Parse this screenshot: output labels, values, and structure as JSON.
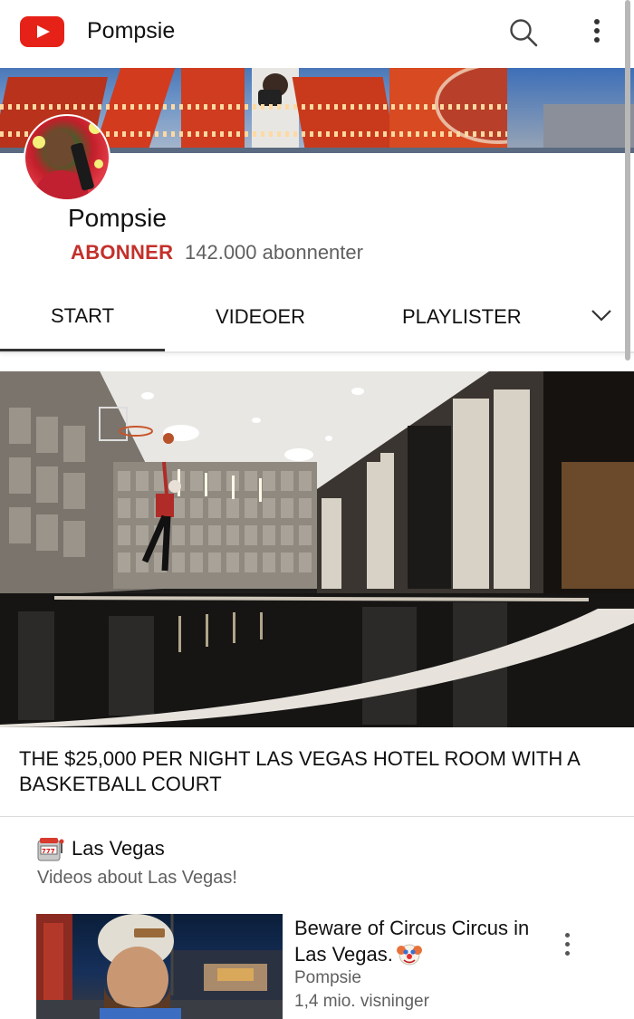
{
  "app": {
    "title": "Pompsie"
  },
  "channel": {
    "name": "Pompsie",
    "subscribe_label": "ABONNER",
    "subscriber_count": "142.000 abonnenter"
  },
  "tabs": [
    {
      "label": "START",
      "active": true
    },
    {
      "label": "VIDEOER",
      "active": false
    },
    {
      "label": "PLAYLISTER",
      "active": false
    }
  ],
  "featured": {
    "title": "THE $25,000 PER NIGHT LAS VEGAS HOTEL ROOM WITH A BASKETBALL COURT"
  },
  "shelf": {
    "icon": "slot-machine-icon",
    "title": "Las Vegas",
    "subtitle": "Videos about Las Vegas!",
    "videos": [
      {
        "title": "Beware of Circus Circus in Las Vegas.",
        "title_icon": "clown-face-icon",
        "channel": "Pompsie",
        "views": "1,4 mio. visninger"
      }
    ]
  },
  "colors": {
    "brand_red": "#e62117",
    "subscribe_red": "#c4302b",
    "secondary_text": "#606060"
  }
}
